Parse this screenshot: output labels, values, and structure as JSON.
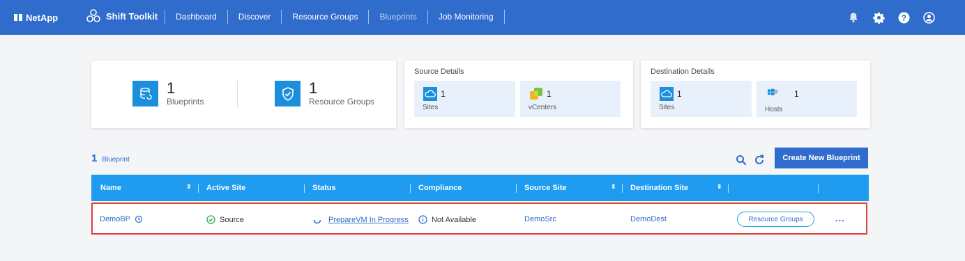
{
  "header": {
    "brand": "NetApp",
    "product": "Shift Toolkit",
    "nav": [
      "Dashboard",
      "Discover",
      "Resource Groups",
      "Blueprints",
      "Job Monitoring"
    ],
    "active_nav": "Blueprints"
  },
  "summary": {
    "blueprints": {
      "count": "1",
      "label": "Blueprints"
    },
    "resource_groups": {
      "count": "1",
      "label": "Resource Groups"
    }
  },
  "source_details": {
    "title": "Source Details",
    "sites": {
      "count": "1",
      "label": "Sites"
    },
    "vcenters": {
      "count": "1",
      "label": "vCenters"
    }
  },
  "destination_details": {
    "title": "Destination Details",
    "sites": {
      "count": "1",
      "label": "Sites"
    },
    "hosts": {
      "count": "1",
      "label": "Hosts"
    }
  },
  "list": {
    "count": "1",
    "count_label": "Blueprint",
    "create_button": "Create New Blueprint"
  },
  "table": {
    "columns": [
      "Name",
      "Active Site",
      "Status",
      "Compliance",
      "Source Site",
      "Destination Site"
    ],
    "rows": [
      {
        "name": "DemoBP",
        "active_site": "Source",
        "status": "PrepareVM In Progress",
        "compliance": "Not Available",
        "source_site": "DemoSrc",
        "destination_site": "DemoDest",
        "action": "Resource Groups",
        "more": "..."
      }
    ]
  },
  "colors": {
    "header_bg": "#2f6ccc",
    "table_header_bg": "#1f9bef",
    "icon_bg": "#1b8fdc",
    "tile_bg": "#e8f1fb",
    "highlight_border": "#e23c3c"
  }
}
